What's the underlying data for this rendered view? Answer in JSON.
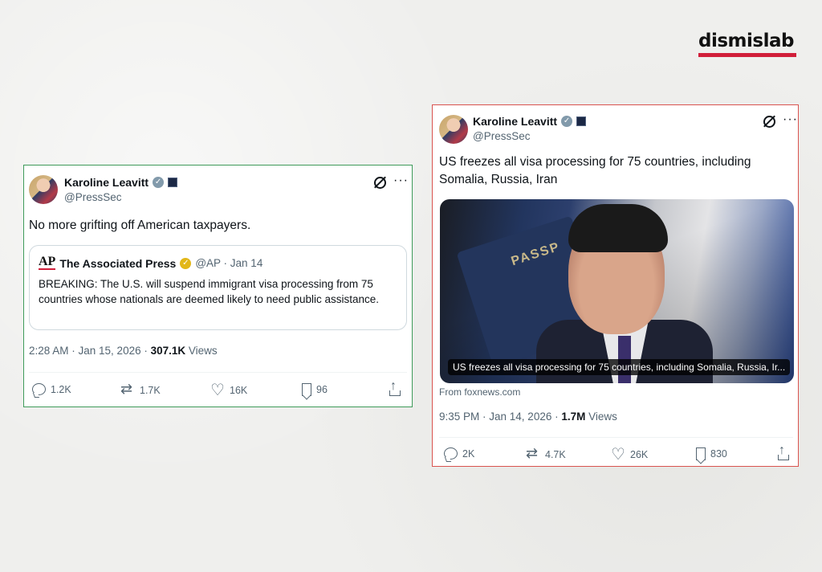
{
  "logo": {
    "text": "dismislab",
    "bar_color": "#d11f3a"
  },
  "left_tweet": {
    "author": {
      "name": "Karoline Leavitt",
      "handle": "@PressSec"
    },
    "text": "No more grifting off American taxpayers.",
    "quote": {
      "logo": "AP",
      "name": "The Associated Press",
      "meta": "@AP · Jan 14",
      "text": "BREAKING: The U.S. will suspend immigrant visa processing from 75 countries whose nationals are deemed likely to need public assistance."
    },
    "timestamp": "2:28 AM · Jan 15, 2026 · ",
    "views_count": "307.1K",
    "views_label": " Views",
    "actions": {
      "replies": "1.2K",
      "reposts": "1.7K",
      "likes": "16K",
      "bookmarks": "96"
    },
    "border_color": "#3f9b5a"
  },
  "right_tweet": {
    "author": {
      "name": "Karoline Leavitt",
      "handle": "@PressSec"
    },
    "text": "US freezes all visa processing for 75 countries, including Somalia, Russia, Iran",
    "media": {
      "caption": "US freezes all visa processing for 75 countries, including Somalia, Russia, Ir...",
      "passport_word": "PASSP"
    },
    "source": "From foxnews.com",
    "timestamp": "9:35 PM · Jan 14, 2026 · ",
    "views_count": "1.7M",
    "views_label": " Views",
    "actions": {
      "replies": "2K",
      "reposts": "4.7K",
      "likes": "26K",
      "bookmarks": "830"
    },
    "border_color": "#d9534f"
  }
}
